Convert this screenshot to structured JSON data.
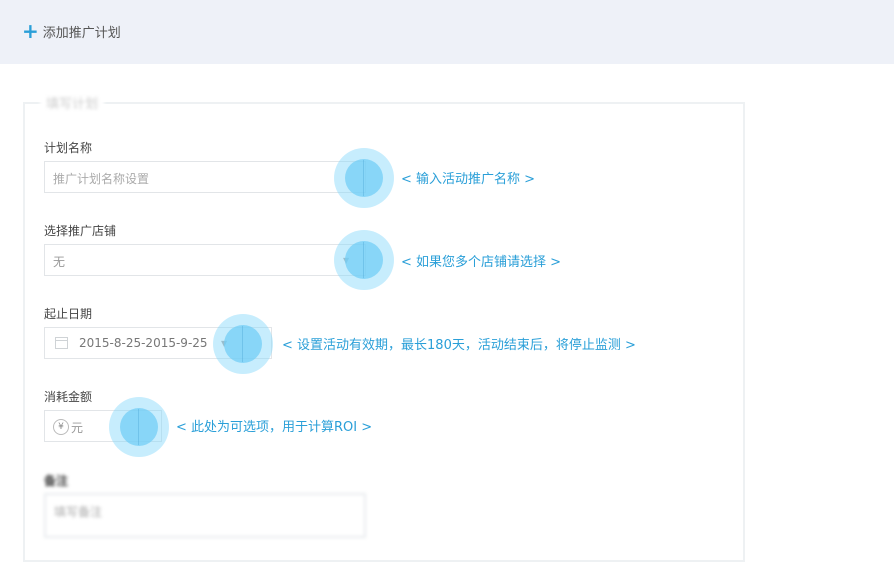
{
  "header": {
    "add_plan_label": "添加推广计划"
  },
  "form": {
    "legend": "填写计划",
    "plan_name": {
      "label": "计划名称",
      "placeholder": "推广计划名称设置",
      "tip": "< 输入活动推广名称 >"
    },
    "shop": {
      "label": "选择推广店铺",
      "value": "无",
      "tip": "< 如果您多个店铺请选择 >"
    },
    "date": {
      "label": "起止日期",
      "value": "2015-8-25-2015-9-25",
      "tip": "< 设置活动有效期，最长180天，活动结束后，将停止监测 >"
    },
    "amount": {
      "label": "消耗金额",
      "currency": "¥",
      "unit": "元",
      "tip": "< 此处为可选项，用于计算ROI >"
    },
    "notes": {
      "label": "备注",
      "placeholder": "填写备注"
    }
  },
  "colors": {
    "accent": "#2a9fd8",
    "header_bg": "#eef1f8",
    "hotspot": "#82d7fa"
  }
}
